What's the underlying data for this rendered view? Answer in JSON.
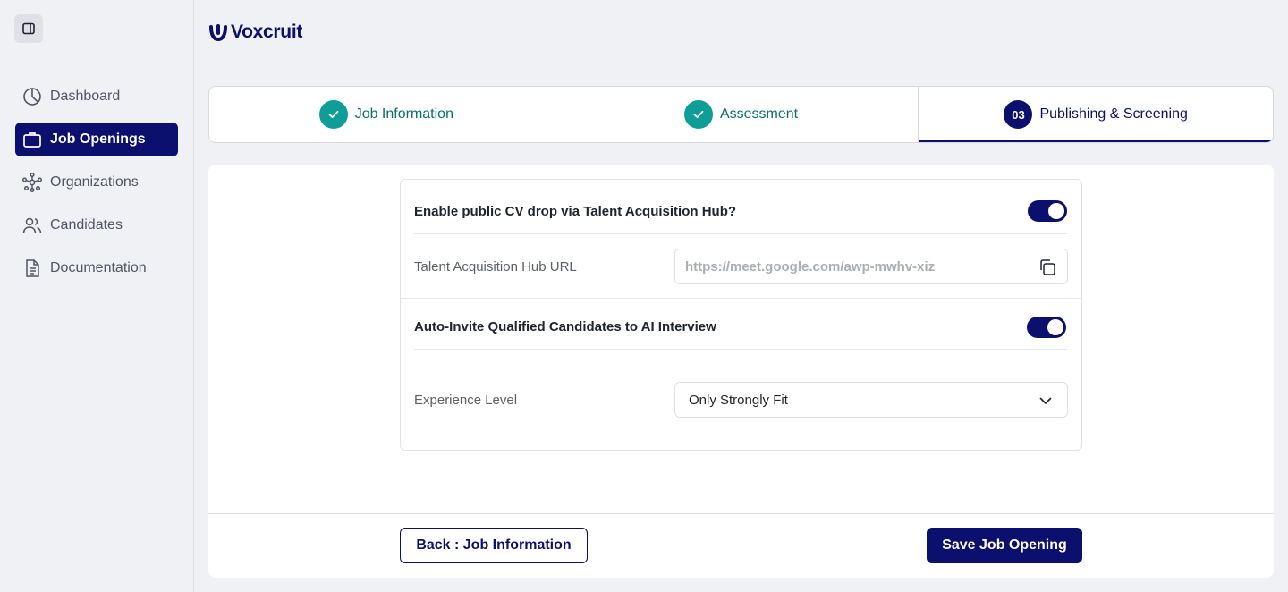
{
  "brand": {
    "name": "Voxcruit",
    "color": "#0b0f6e",
    "accent": "#0e9e97"
  },
  "sidebar": {
    "collapse_icon": "sidebar-toggle-icon",
    "items": [
      {
        "label": "Dashboard",
        "icon": "pie-chart-icon",
        "active": false
      },
      {
        "label": "Job Openings",
        "icon": "briefcase-icon",
        "active": true
      },
      {
        "label": "Organizations",
        "icon": "network-icon",
        "active": false
      },
      {
        "label": "Candidates",
        "icon": "users-icon",
        "active": false
      },
      {
        "label": "Documentation",
        "icon": "document-icon",
        "active": false
      }
    ]
  },
  "stepper": {
    "steps": [
      {
        "label": "Job Information",
        "status": "done"
      },
      {
        "label": "Assessment",
        "status": "done"
      },
      {
        "badge": "03",
        "label": "Publishing & Screening",
        "status": "current"
      }
    ]
  },
  "form": {
    "cv_drop": {
      "title": "Enable public CV drop via Talent Acquisition Hub?",
      "enabled": true
    },
    "hub_url": {
      "label": "Talent Acquisition Hub URL",
      "value": "https://meet.google.com/awp-mwhv-xiz"
    },
    "auto_invite": {
      "title": "Auto-Invite Qualified Candidates to AI Interview",
      "enabled": true
    },
    "experience": {
      "label": "Experience Level",
      "selected": "Only Strongly Fit"
    }
  },
  "footer": {
    "back_label": "Back : Job Information",
    "save_label": "Save Job Opening"
  }
}
